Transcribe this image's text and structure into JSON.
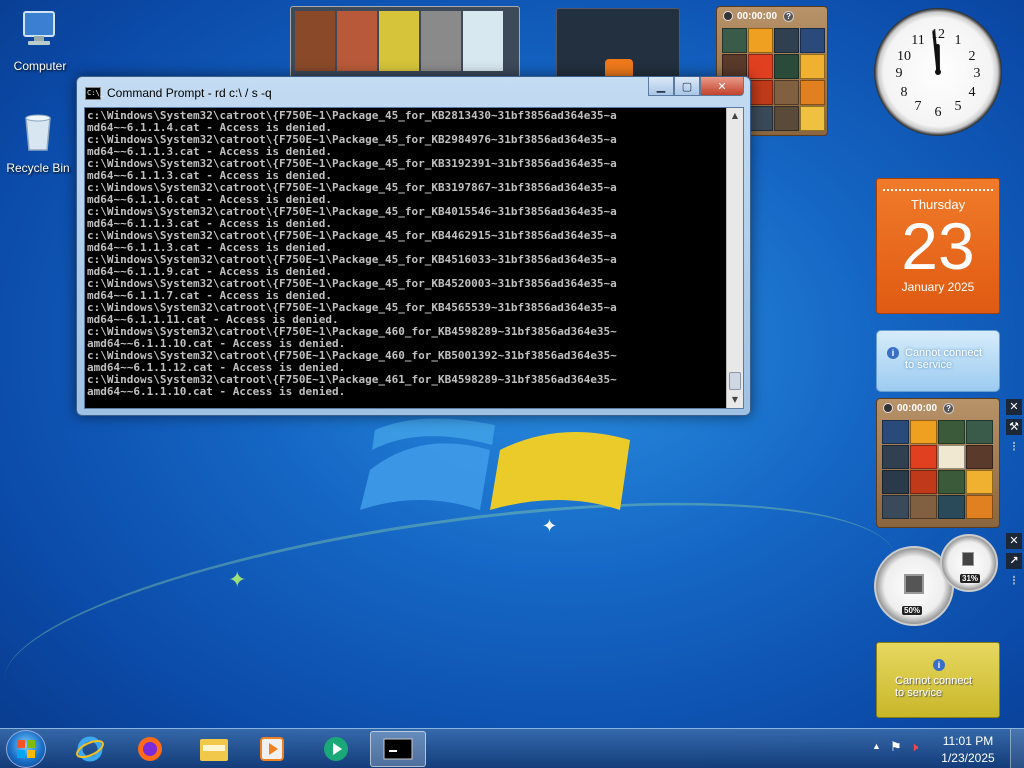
{
  "desktop": {
    "icons": [
      {
        "label": "Computer"
      },
      {
        "label": "Recycle Bin"
      }
    ]
  },
  "cmd_window": {
    "title": "Command Prompt - rd  c:\\ / s -q",
    "icon_text": "C:\\_",
    "lines": [
      "c:\\Windows\\System32\\catroot\\{F750E~1\\Package_45_for_KB2813430~31bf3856ad364e35~a",
      "md64~~6.1.1.4.cat - Access is denied.",
      "c:\\Windows\\System32\\catroot\\{F750E~1\\Package_45_for_KB2984976~31bf3856ad364e35~a",
      "md64~~6.1.1.3.cat - Access is denied.",
      "c:\\Windows\\System32\\catroot\\{F750E~1\\Package_45_for_KB3192391~31bf3856ad364e35~a",
      "md64~~6.1.1.3.cat - Access is denied.",
      "c:\\Windows\\System32\\catroot\\{F750E~1\\Package_45_for_KB3197867~31bf3856ad364e35~a",
      "md64~~6.1.1.6.cat - Access is denied.",
      "c:\\Windows\\System32\\catroot\\{F750E~1\\Package_45_for_KB4015546~31bf3856ad364e35~a",
      "md64~~6.1.1.3.cat - Access is denied.",
      "c:\\Windows\\System32\\catroot\\{F750E~1\\Package_45_for_KB4462915~31bf3856ad364e35~a",
      "md64~~6.1.1.3.cat - Access is denied.",
      "c:\\Windows\\System32\\catroot\\{F750E~1\\Package_45_for_KB4516033~31bf3856ad364e35~a",
      "md64~~6.1.1.9.cat - Access is denied.",
      "c:\\Windows\\System32\\catroot\\{F750E~1\\Package_45_for_KB4520003~31bf3856ad364e35~a",
      "md64~~6.1.1.7.cat - Access is denied.",
      "c:\\Windows\\System32\\catroot\\{F750E~1\\Package_45_for_KB4565539~31bf3856ad364e35~a",
      "md64~~6.1.1.11.cat - Access is denied.",
      "c:\\Windows\\System32\\catroot\\{F750E~1\\Package_460_for_KB4598289~31bf3856ad364e35~",
      "amd64~~6.1.1.10.cat - Access is denied.",
      "c:\\Windows\\System32\\catroot\\{F750E~1\\Package_460_for_KB5001392~31bf3856ad364e35~",
      "amd64~~6.1.1.12.cat - Access is denied.",
      "c:\\Windows\\System32\\catroot\\{F750E~1\\Package_461_for_KB4598289~31bf3856ad364e35~",
      "amd64~~6.1.1.10.cat - Access is denied."
    ]
  },
  "gadgets": {
    "puzzle_top": {
      "timer": "00:00:00",
      "help": "?"
    },
    "puzzle_bottom": {
      "timer": "00:00:00",
      "help": "?"
    },
    "calendar": {
      "weekday": "Thursday",
      "day": "23",
      "month_year": "January 2025"
    },
    "weather_service": {
      "line1": "Cannot connect",
      "line2": "to service"
    },
    "feed_service": {
      "line1": "Cannot connect",
      "line2": "to service"
    },
    "cpu_meter": {
      "cpu": "50%",
      "memory": "31%"
    },
    "clock": {
      "hour": 11,
      "minute": 59
    }
  },
  "taskbar": {
    "apps": [
      "internet-explorer",
      "firefox",
      "file-explorer",
      "media-player",
      "media-center",
      "command-prompt"
    ],
    "tray": {
      "time": "11:01 PM",
      "date": "1/23/2025"
    }
  },
  "colors": {
    "calendar": "#e8661e",
    "service_blue": "#9ccbf0",
    "service_yellow": "#d4c43a",
    "cmd_bg": "#000000",
    "cmd_text": "#c0c0c0"
  }
}
